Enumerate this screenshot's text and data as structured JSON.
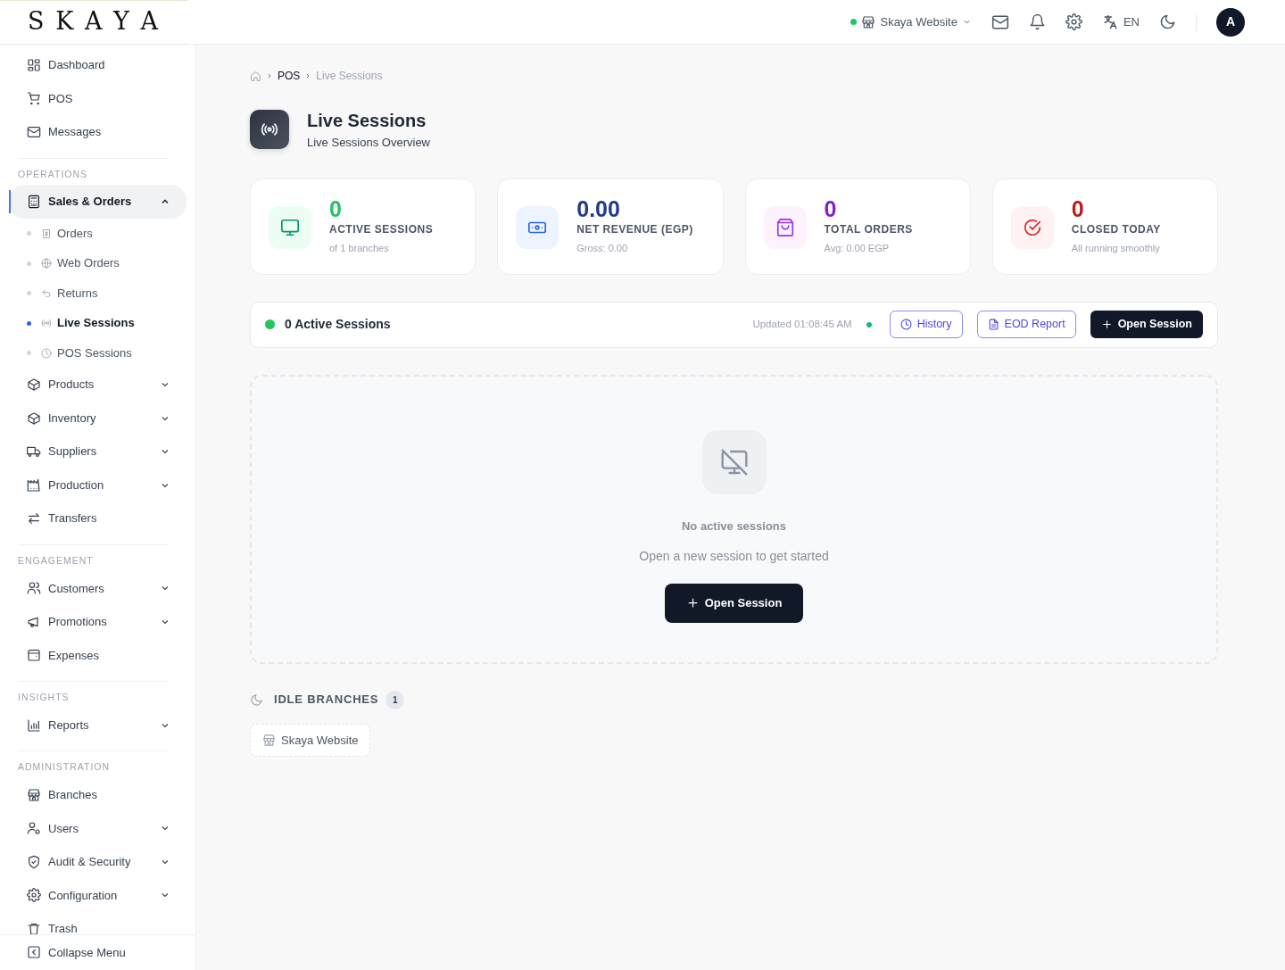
{
  "brand": {
    "logo": "S K A Y A"
  },
  "topbar": {
    "branch": {
      "label": "Skaya Website",
      "online": true
    },
    "language": "EN",
    "avatar": "A"
  },
  "sidebar": {
    "sections": [
      {
        "items": [
          {
            "label": "Dashboard",
            "kind": "link",
            "selected": false
          },
          {
            "label": "POS",
            "kind": "link",
            "selected": false
          },
          {
            "label": "Messages",
            "kind": "link",
            "selected": false
          }
        ]
      },
      {
        "heading": "OPERATIONS",
        "items": [
          {
            "label": "Sales & Orders",
            "kind": "group",
            "selected": true,
            "expanded": true,
            "children": [
              {
                "label": "Orders",
                "selected": false
              },
              {
                "label": "Web Orders",
                "selected": false
              },
              {
                "label": "Returns",
                "selected": false
              },
              {
                "label": "Live Sessions",
                "selected": true
              },
              {
                "label": "POS Sessions",
                "selected": false
              }
            ]
          },
          {
            "label": "Products",
            "kind": "group",
            "selected": false,
            "expanded": false
          },
          {
            "label": "Inventory",
            "kind": "group",
            "selected": false,
            "expanded": false
          },
          {
            "label": "Suppliers",
            "kind": "group",
            "selected": false,
            "expanded": false
          },
          {
            "label": "Production",
            "kind": "group",
            "selected": false,
            "expanded": false
          },
          {
            "label": "Transfers",
            "kind": "link",
            "selected": false
          }
        ]
      },
      {
        "heading": "ENGAGEMENT",
        "items": [
          {
            "label": "Customers",
            "kind": "group",
            "selected": false,
            "expanded": false
          },
          {
            "label": "Promotions",
            "kind": "group",
            "selected": false,
            "expanded": false
          },
          {
            "label": "Expenses",
            "kind": "link",
            "selected": false
          }
        ]
      },
      {
        "heading": "INSIGHTS",
        "items": [
          {
            "label": "Reports",
            "kind": "group",
            "selected": false,
            "expanded": false
          }
        ]
      },
      {
        "heading": "ADMINISTRATION",
        "items": [
          {
            "label": "Branches",
            "kind": "link",
            "selected": false
          },
          {
            "label": "Users",
            "kind": "group",
            "selected": false,
            "expanded": false
          },
          {
            "label": "Audit & Security",
            "kind": "group",
            "selected": false,
            "expanded": false
          },
          {
            "label": "Configuration",
            "kind": "group",
            "selected": false,
            "expanded": false
          },
          {
            "label": "Trash",
            "kind": "link",
            "selected": false
          }
        ]
      }
    ],
    "footer": "Collapse Menu"
  },
  "breadcrumb": [
    "POS",
    "Live Sessions"
  ],
  "page": {
    "title": "Live Sessions",
    "subtitle": "Live Sessions Overview"
  },
  "stats": [
    {
      "value": "0",
      "label": "ACTIVE SESSIONS",
      "note": "of 1 branches",
      "color": "#22c55e"
    },
    {
      "value": "0.00",
      "label": "NET REVENUE (EGP)",
      "note": "Gross: 0.00",
      "color": "#1e3a8a"
    },
    {
      "value": "0",
      "label": "TOTAL ORDERS",
      "note": "Avg: 0.00 EGP",
      "color": "#7e22ce"
    },
    {
      "value": "0",
      "label": "CLOSED TODAY",
      "note": "All running smoothly",
      "color": "#b91c1c"
    }
  ],
  "sessions_bar": {
    "title": "0 Active Sessions",
    "updated": "Updated 01:08:45 AM",
    "live": true,
    "buttons": [
      "History",
      "EOD Report",
      "Open Session"
    ]
  },
  "empty_state": {
    "title": "No active sessions",
    "message": "Open a new session to get started",
    "button": "Open Session"
  },
  "idle_branches": {
    "title": "IDLE BRANCHES",
    "count": "1",
    "branches": [
      "Skaya Website"
    ]
  }
}
